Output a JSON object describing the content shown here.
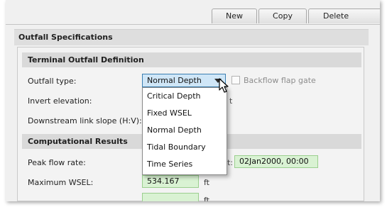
{
  "toolbar": {
    "new_label": "New",
    "copy_label": "Copy",
    "delete_label": "Delete"
  },
  "outfall": {
    "section_title": "Outfall Specifications",
    "terminal_title": "Terminal Outfall Definition",
    "outfall_type_label": "Outfall type:",
    "outfall_type_value": "Normal Depth",
    "backflow_label": "Backflow flap gate",
    "backflow_checked": false,
    "invert_label": "Invert elevation:",
    "downstream_label": "Downstream link slope (H:V):",
    "hidden_fragment": "t"
  },
  "dropdown": {
    "options": [
      "Critical Depth",
      "Fixed WSEL",
      "Normal Depth",
      "Tidal Boundary",
      "Time Series"
    ]
  },
  "results": {
    "title": "Computational Results",
    "peak_flow_label": "Peak flow rate:",
    "peak_time_suffix": "t:",
    "peak_time_value": "02Jan2000, 00:00",
    "max_wsel_label": "Maximum WSEL:",
    "max_wsel_value": "534.167",
    "max_wsel_unit": "ft",
    "next_unit": "ft"
  },
  "colors": {
    "panel_bg": "#f0f0f0",
    "header_bg": "#dedede",
    "selected_bg": "#cfe6f7",
    "selected_border": "#3c7fb1",
    "result_field_bg": "#d9f2d3"
  }
}
